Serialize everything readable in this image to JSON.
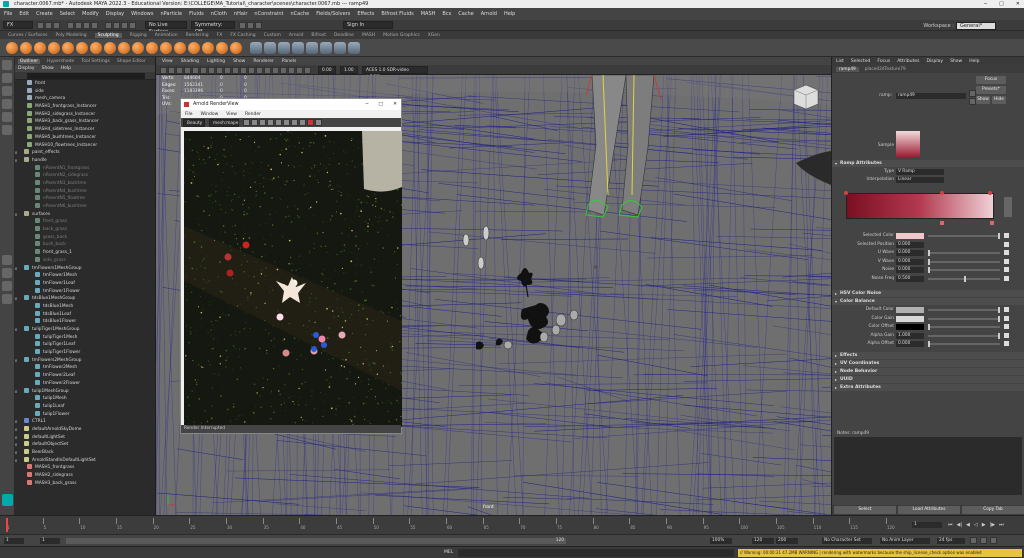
{
  "window": {
    "title": "character.0067.mb* - Autodesk MAYA 2022.3 - Educational Version: E:\\COLLEGE\\MA_Tutorial\\_character\\scenes\\character.0067.mb --- ramp49"
  },
  "menubar": [
    "File",
    "Edit",
    "Create",
    "Select",
    "Modify",
    "Display",
    "Windows",
    "nParticle",
    "Fluids",
    "nCloth",
    "nHair",
    "nConstraint",
    "nCache",
    "Fields/Solvers",
    "Effects",
    "Bifrost Fluids",
    "MASH",
    "Bcs",
    "Cache",
    "Arnold",
    "Help"
  ],
  "status": {
    "mode": "FX",
    "sign_in": "Sign In",
    "workspace_label": "Workspace :",
    "workspace": "General*",
    "symmetry": "Symmetry: Off",
    "live": "No Live Surface"
  },
  "shelf_tabs": [
    "Curves / Surfaces",
    "Poly Modeling",
    "Sculpting",
    "Rigging",
    "Animation",
    "Rendering",
    "FX",
    "FX Caching",
    "Custom",
    "Arnold",
    "Bifrost",
    "Deadline",
    "MASH",
    "Motion Graphics",
    "XGen"
  ],
  "shelf_active": "Sculpting",
  "outliner": {
    "tabs": [
      "Outliner",
      "Hypershade",
      "Tool Settings",
      "Shape Editor"
    ],
    "active_tab": "Outliner",
    "menu": [
      "Display",
      "Show",
      "Help"
    ],
    "items": [
      {
        "label": "front",
        "indent": 1,
        "grey": false,
        "color": "#9ab"
      },
      {
        "label": "side",
        "indent": 1,
        "grey": false,
        "color": "#9ab"
      },
      {
        "label": "mesh_camera",
        "indent": 1,
        "grey": false,
        "color": "#9ab"
      },
      {
        "label": "MASH1_frontgrass_Instancer",
        "indent": 1,
        "grey": false,
        "color": "#8a7"
      },
      {
        "label": "MASH2_sidegrass_Instancer",
        "indent": 1,
        "grey": false,
        "color": "#8a7"
      },
      {
        "label": "MASH3_back_grass_Instancer",
        "indent": 1,
        "grey": false,
        "color": "#8a7"
      },
      {
        "label": "MASH4_sidetrees_Instancer",
        "indent": 1,
        "grey": false,
        "color": "#8a7"
      },
      {
        "label": "MASH5_bushtrees_Instancer",
        "indent": 1,
        "grey": false,
        "color": "#8a7"
      },
      {
        "label": "MASH10_flowtrees_Instancer",
        "indent": 1,
        "grey": false,
        "color": "#8a7"
      },
      {
        "label": "paint_effects",
        "indent": 0,
        "grey": false,
        "color": "#aa8"
      },
      {
        "label": "handle",
        "indent": 0,
        "grey": false,
        "color": "#aa8"
      },
      {
        "label": "nParentN1_frontgrass",
        "indent": 2,
        "grey": true,
        "color": "#687"
      },
      {
        "label": "nParentN2_sidegrass",
        "indent": 2,
        "grey": true,
        "color": "#687"
      },
      {
        "label": "nParentN3_backtree",
        "indent": 2,
        "grey": true,
        "color": "#687"
      },
      {
        "label": "nParentN4_bushtree",
        "indent": 2,
        "grey": true,
        "color": "#687"
      },
      {
        "label": "nParentN5_flowtree",
        "indent": 2,
        "grey": true,
        "color": "#687"
      },
      {
        "label": "nParentN6_bushtree",
        "indent": 2,
        "grey": true,
        "color": "#687"
      },
      {
        "label": "surfaces",
        "indent": 0,
        "grey": false,
        "color": "#aa8"
      },
      {
        "label": "front_grass",
        "indent": 2,
        "grey": true,
        "color": "#687"
      },
      {
        "label": "back_grass",
        "indent": 2,
        "grey": true,
        "color": "#687"
      },
      {
        "label": "grass_back",
        "indent": 2,
        "grey": true,
        "color": "#687"
      },
      {
        "label": "bush_back",
        "indent": 2,
        "grey": true,
        "color": "#687"
      },
      {
        "label": "front_grass_1",
        "indent": 2,
        "grey": false,
        "color": "#687"
      },
      {
        "label": "side_grass",
        "indent": 2,
        "grey": true,
        "color": "#687"
      },
      {
        "label": "tmFlowers1MeshGroup",
        "indent": 0,
        "grey": false,
        "color": "#6ab"
      },
      {
        "label": "tmFlower1Mesh",
        "indent": 2,
        "grey": false,
        "color": "#6ab"
      },
      {
        "label": "tmFlower1Leaf",
        "indent": 2,
        "grey": false,
        "color": "#6ab"
      },
      {
        "label": "tmFlower1Flower",
        "indent": 2,
        "grey": false,
        "color": "#6ab"
      },
      {
        "label": "tdsBlue1MeshGroup",
        "indent": 0,
        "grey": false,
        "color": "#6ab"
      },
      {
        "label": "tdsBlue1Mesh",
        "indent": 2,
        "grey": false,
        "color": "#6ab"
      },
      {
        "label": "tdsBlue1Leaf",
        "indent": 2,
        "grey": false,
        "color": "#6ab"
      },
      {
        "label": "tdsBlue1Flower",
        "indent": 2,
        "grey": false,
        "color": "#6ab"
      },
      {
        "label": "tulipTiger1MeshGroup",
        "indent": 0,
        "grey": false,
        "color": "#6ab"
      },
      {
        "label": "tulipTiger1Mesh",
        "indent": 2,
        "grey": false,
        "color": "#6ab"
      },
      {
        "label": "tulipTiger1Leaf",
        "indent": 2,
        "grey": false,
        "color": "#6ab"
      },
      {
        "label": "tulipTiger1Flower",
        "indent": 2,
        "grey": false,
        "color": "#6ab"
      },
      {
        "label": "tmFlowers2MeshGroup",
        "indent": 0,
        "grey": false,
        "color": "#6ab"
      },
      {
        "label": "tmFlower2Mesh",
        "indent": 2,
        "grey": false,
        "color": "#6ab"
      },
      {
        "label": "tmFlower2Leaf",
        "indent": 2,
        "grey": false,
        "color": "#6ab"
      },
      {
        "label": "tmFlower2Flower",
        "indent": 2,
        "grey": false,
        "color": "#6ab"
      },
      {
        "label": "tulip1MeshGroup",
        "indent": 0,
        "grey": false,
        "color": "#6ab"
      },
      {
        "label": "tulip1Mesh",
        "indent": 2,
        "grey": false,
        "color": "#6ab"
      },
      {
        "label": "tulip1Leaf",
        "indent": 2,
        "grey": false,
        "color": "#6ab"
      },
      {
        "label": "tulip1Flower",
        "indent": 2,
        "grey": false,
        "color": "#6ab"
      },
      {
        "label": "CTRL1",
        "indent": 0,
        "grey": false,
        "color": "#68c"
      },
      {
        "label": "defaultArnoldSkyDome",
        "indent": 0,
        "grey": false,
        "color": "#cc8"
      },
      {
        "label": "defaultLightSet",
        "indent": 0,
        "grey": false,
        "color": "#cc8"
      },
      {
        "label": "defaultObjectSet",
        "indent": 0,
        "grey": false,
        "color": "#cc8"
      },
      {
        "label": "BeerBlack",
        "indent": 0,
        "grey": false,
        "color": "#cc8"
      },
      {
        "label": "ArnoldStandInDefaultLightSet",
        "indent": 0,
        "grey": false,
        "color": "#cc8"
      },
      {
        "label": "MASH1_frontgrass",
        "indent": 1,
        "grey": false,
        "color": "#d77"
      },
      {
        "label": "MASH2_sidegrass",
        "indent": 1,
        "grey": false,
        "color": "#d77"
      },
      {
        "label": "MASH3_back_grass",
        "indent": 1,
        "grey": false,
        "color": "#d77"
      }
    ]
  },
  "viewport": {
    "menu": [
      "View",
      "Shading",
      "Lighting",
      "Show",
      "Renderer",
      "Panels"
    ],
    "hud": [
      {
        "k": "Verts:",
        "v": "844604",
        "a": "0",
        "b": "0"
      },
      {
        "k": "Edges:",
        "v": "1562341",
        "a": "0",
        "b": "0"
      },
      {
        "k": "Faces:",
        "v": "1183396",
        "a": "0",
        "b": "0"
      },
      {
        "k": "Tris:",
        "v": "",
        "a": "0",
        "b": "0"
      },
      {
        "k": "UVs:",
        "v": "",
        "a": "0",
        "b": "0"
      }
    ],
    "gamma": "ACES 1.0 SDR-video (sRGB)",
    "val1": "0.00",
    "val2": "1.00",
    "camera_label": "front"
  },
  "render_view": {
    "title": "Arnold RenderView",
    "menu": [
      "File",
      "Window",
      "View",
      "Render"
    ],
    "aov": "Beauty",
    "camera": "mesh:mape",
    "status": "Render Interrupted"
  },
  "attribute_editor": {
    "tabs": [
      "List",
      "Selected",
      "Focus",
      "Attributes",
      "Display",
      "Show",
      "Help"
    ],
    "node_tabs": [
      "ramp49",
      "placed2dTexture79"
    ],
    "ramp_label": "ramp:",
    "ramp_name": "ramp49",
    "buttons": {
      "focus": "Focus",
      "presets": "Presets*",
      "show": "Show",
      "hide": "Hide"
    },
    "sample": "Sample",
    "sections": [
      "Ramp Attributes",
      "HSV Color Noise",
      "Color Balance",
      "Effects",
      "UV Coordinates",
      "Node Behavior",
      "UUID",
      "Extra Attributes"
    ],
    "type_label": "Type",
    "type_value": "V Ramp",
    "interp_label": "Interpolation",
    "interp_value": "Linear",
    "ramp_fields": [
      {
        "label": "Selected Color",
        "value": ""
      },
      {
        "label": "Selected Position",
        "value": "0.000"
      },
      {
        "label": "U Wave",
        "value": "0.000"
      },
      {
        "label": "V Wave",
        "value": "0.000"
      },
      {
        "label": "Noise",
        "value": "0.000"
      },
      {
        "label": "Noise Freq",
        "value": "0.500"
      }
    ],
    "cb_fields": [
      {
        "label": "Default Color",
        "value": ""
      },
      {
        "label": "Color Gain",
        "value": ""
      },
      {
        "label": "Color Offset",
        "value": ""
      },
      {
        "label": "Alpha Gain",
        "value": "1.000"
      },
      {
        "label": "Alpha Offset",
        "value": "0.000"
      }
    ],
    "notes": "Notes: ramp49",
    "bottom_buttons": [
      "Select",
      "Load Attributes",
      "Copy Tab"
    ]
  },
  "timeline": {
    "ticks": [
      "1",
      "5",
      "10",
      "15",
      "20",
      "25",
      "30",
      "35",
      "40",
      "45",
      "50",
      "55",
      "60",
      "65",
      "70",
      "75",
      "80",
      "85",
      "90",
      "95",
      "100",
      "105",
      "110",
      "115",
      "120"
    ],
    "current": "1"
  },
  "range": {
    "start": "1",
    "start2": "1",
    "mid": "120",
    "end": "120",
    "end2": "200",
    "fps": "24 fps",
    "char_set": "No Character Set",
    "anim_layer": "No Anim Layer",
    "pct": "100%"
  },
  "cmd": {
    "lang": "MEL",
    "warning": "// Warning: 00:00:31 47.2MB WARNING | rendering with watermarks because the ship_license_check option was enabled"
  }
}
